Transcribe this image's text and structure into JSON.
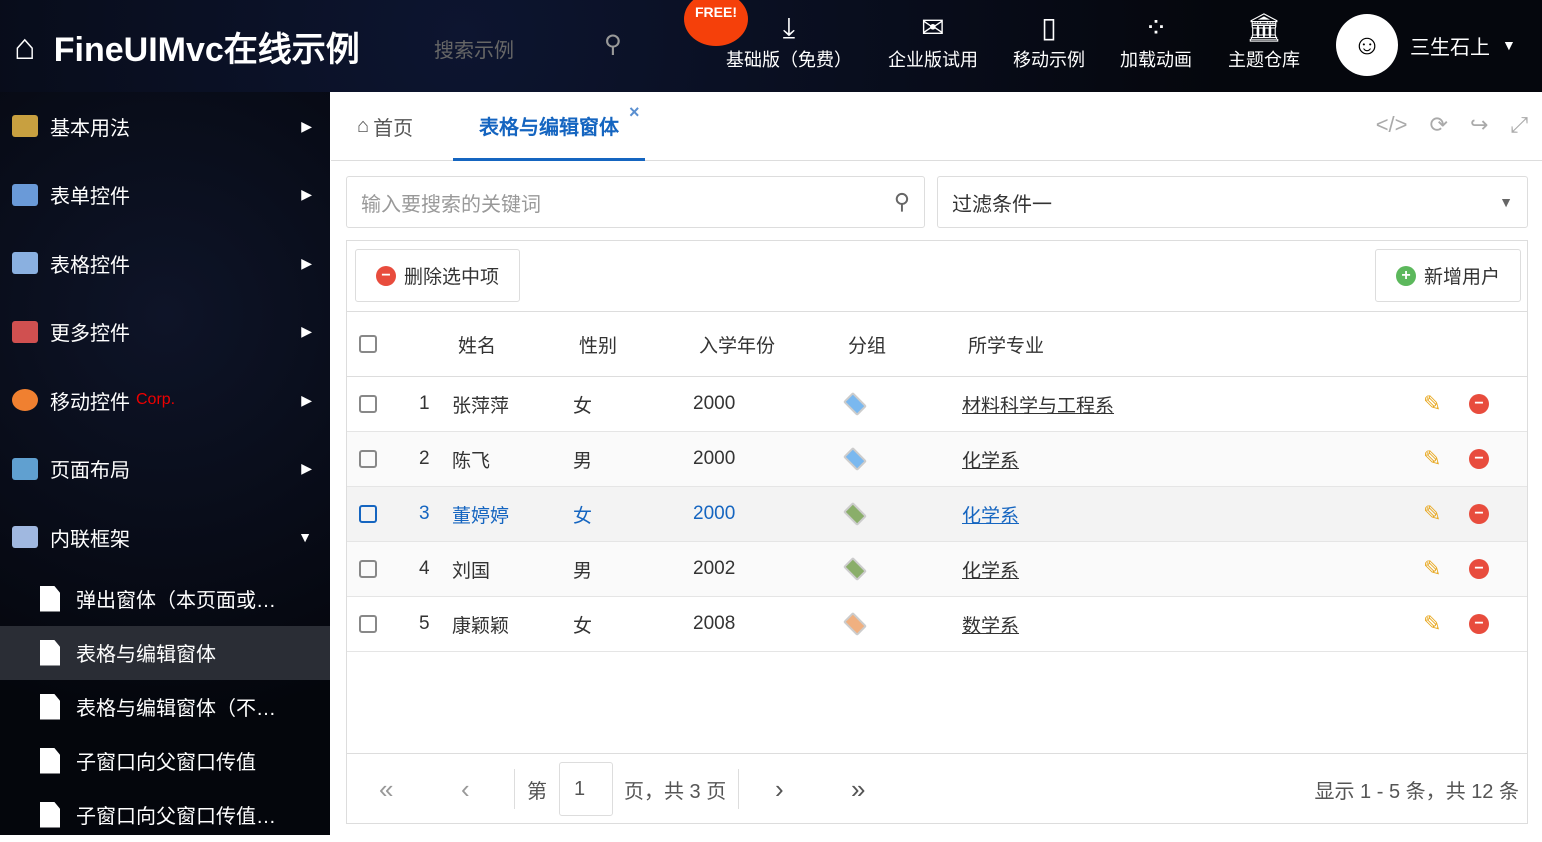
{
  "header": {
    "title": "FineUIMvc在线示例",
    "search_placeholder": "搜索示例",
    "free_badge": "FREE!",
    "nav": [
      {
        "label": "基础版（免费）",
        "icon": "download-icon"
      },
      {
        "label": "企业版试用",
        "icon": "envelope-icon"
      },
      {
        "label": "移动示例",
        "icon": "mobile-icon"
      },
      {
        "label": "加载动画",
        "icon": "spinner-icon"
      },
      {
        "label": "主题仓库",
        "icon": "bank-icon"
      }
    ],
    "user": "三生石上"
  },
  "sidebar": {
    "items": [
      {
        "label": "基本用法",
        "color": "#c8a040"
      },
      {
        "label": "表单控件",
        "color": "#6a9ad8"
      },
      {
        "label": "表格控件",
        "color": "#8ab0e0"
      },
      {
        "label": "更多控件",
        "color": "#d05050"
      },
      {
        "label": "移动控件",
        "badge": "Corp.",
        "color": "#f08030"
      },
      {
        "label": "页面布局",
        "color": "#60a0d0"
      },
      {
        "label": "内联框架",
        "color": "#a0b8e0"
      }
    ],
    "subitems": [
      "弹出窗体（本页面或…",
      "表格与编辑窗体",
      "表格与编辑窗体（不…",
      "子窗口向父窗口传值",
      "子窗口向父窗口传值…"
    ]
  },
  "tabs": [
    {
      "label": "首页"
    },
    {
      "label": "表格与编辑窗体"
    }
  ],
  "search": {
    "placeholder": "输入要搜索的关键词",
    "filter": "过滤条件一"
  },
  "toolbar": {
    "delete": "删除选中项",
    "add": "新增用户"
  },
  "grid": {
    "columns": [
      "姓名",
      "性别",
      "入学年份",
      "分组",
      "所学专业"
    ],
    "rows": [
      {
        "no": "1",
        "name": "张萍萍",
        "gender": "女",
        "year": "2000",
        "tag": "#7ab8ef",
        "major": "材料科学与工程系"
      },
      {
        "no": "2",
        "name": "陈飞",
        "gender": "男",
        "year": "2000",
        "tag": "#7ab8ef",
        "major": "化学系"
      },
      {
        "no": "3",
        "name": "董婷婷",
        "gender": "女",
        "year": "2000",
        "tag": "#8aae6a",
        "major": "化学系"
      },
      {
        "no": "4",
        "name": "刘国",
        "gender": "男",
        "year": "2002",
        "tag": "#8aae6a",
        "major": "化学系"
      },
      {
        "no": "5",
        "name": "康颖颖",
        "gender": "女",
        "year": "2008",
        "tag": "#f0b080",
        "major": "数学系"
      }
    ]
  },
  "pager": {
    "prefix": "第",
    "page": "1",
    "suffix": "页，共 3 页",
    "summary": "显示 1 - 5 条，共 12 条"
  }
}
